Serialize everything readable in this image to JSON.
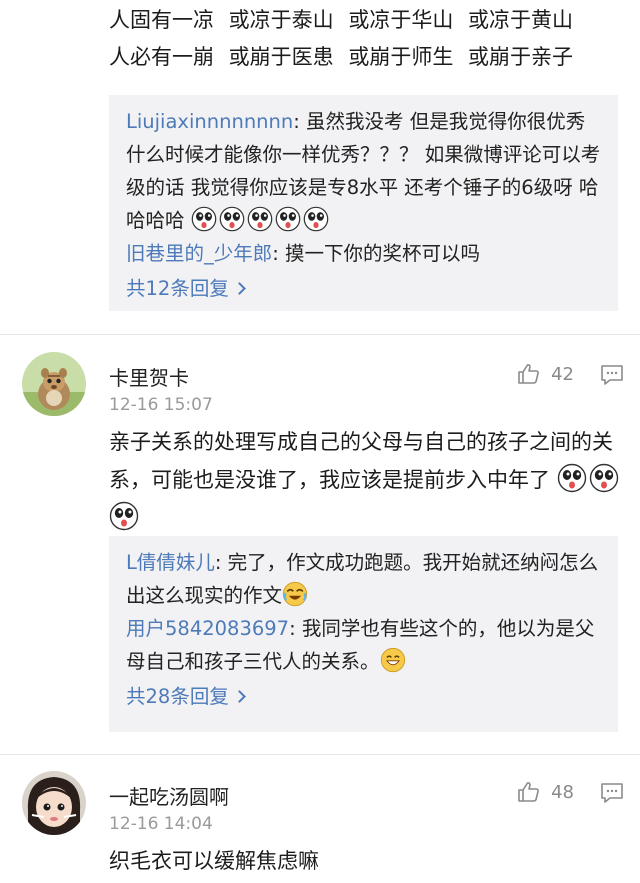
{
  "poem": {
    "line1": "人固有一凉  或凉于泰山  或凉于华山  或凉于黄山",
    "line2": "人必有一崩  或崩于医患  或崩于师生  或崩于亲子"
  },
  "reply_box_1": {
    "replies": [
      {
        "user": "Liujiaxinnnnnnnn",
        "text": ": 虽然我没考 但是我觉得你很优秀什么时候才能像你一样优秀？？？ 如果微博评论可以考级的话 我觉得你应该是专8水平 还考个锤子的6级呀 哈哈哈哈"
      },
      {
        "user": "旧巷里的_少年郎",
        "text": ": 摸一下你的奖杯可以吗"
      }
    ],
    "more_label": "共12条回复"
  },
  "comment_1": {
    "name": "卡里贺卡",
    "time": "12-16 15:07",
    "likes": "42",
    "text": "亲子关系的处理写成自己的父母与自己的孩子之间的关系，可能也是没谁了，我应该是提前步入中年了",
    "avatar": "squirrel-avatar"
  },
  "reply_box_2": {
    "replies": [
      {
        "user": "L倩倩妹儿",
        "text": ": 完了，作文成功跑题。我开始就还纳闷怎么出这么现实的作文"
      },
      {
        "user": "用户5842083697",
        "text": ": 我同学也有些这个的，他以为是父母自己和孩子三代人的关系。"
      }
    ],
    "more_label": "共28条回复"
  },
  "comment_2": {
    "name": "一起吃汤圆啊",
    "time": "12-16 14:04",
    "likes": "48",
    "text": "织毛衣可以缓解焦虑嘛",
    "avatar": "child-avatar"
  },
  "colors": {
    "link": "#4d7ab8",
    "reply_bg": "#f2f2f4",
    "meta": "#9a9a9a"
  },
  "icons": [
    "thumbs-up-icon",
    "comment-icon",
    "surprised-emoji",
    "laugh-cry-emoji",
    "grin-emoji"
  ]
}
